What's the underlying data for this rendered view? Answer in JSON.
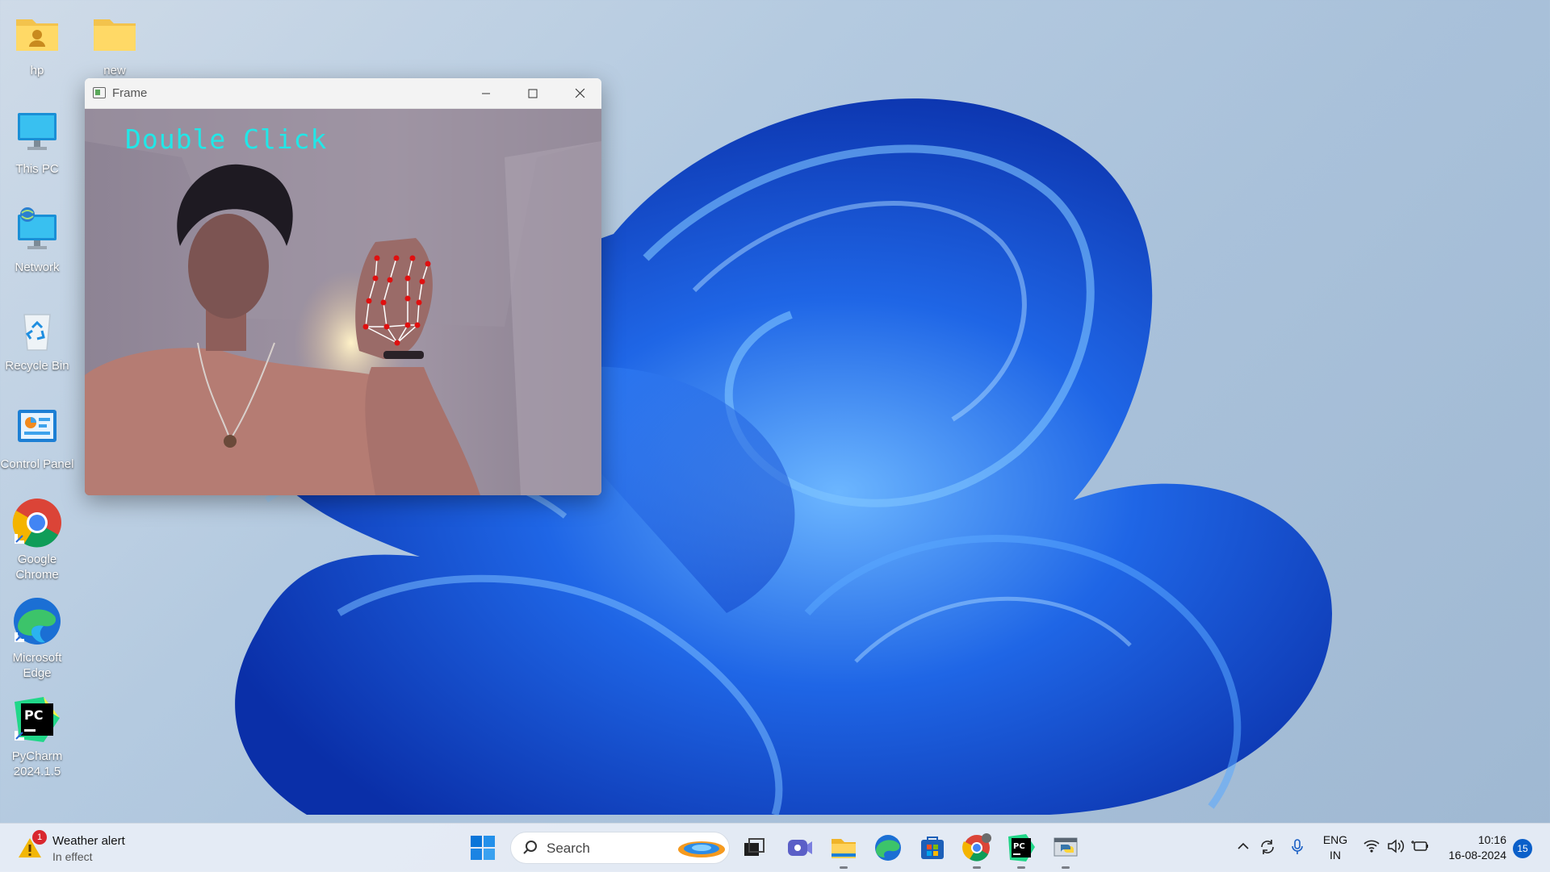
{
  "desktop": {
    "icons": [
      {
        "label": "hp"
      },
      {
        "label": "new"
      },
      {
        "label": "This PC"
      },
      {
        "label": "Network"
      },
      {
        "label": "Recycle Bin"
      },
      {
        "label": "Control Panel"
      },
      {
        "label": "Google Chrome"
      },
      {
        "label": "Microsoft Edge"
      },
      {
        "label": "PyCharm 2024.1.5"
      }
    ]
  },
  "window": {
    "title": "Frame",
    "overlay_text": "Double Click",
    "overlay_color": "#21e7e7",
    "landmark_color": "#e01010"
  },
  "taskbar": {
    "weather": {
      "title": "Weather alert",
      "subtitle": "In effect",
      "badge": "1"
    },
    "search": {
      "placeholder": "Search"
    },
    "apps": [
      "start-icon",
      "task-view-icon",
      "meet-icon",
      "file-explorer-icon",
      "edge-icon",
      "store-icon",
      "chrome-icon",
      "pycharm-icon",
      "python-icon"
    ],
    "tray": {
      "language": "ENG",
      "region": "IN",
      "time": "10:16",
      "date": "16-08-2024",
      "notifications": "15"
    }
  },
  "colors": {
    "accent": "#0a5fc9",
    "wallpaper_blue": "#1a5fe0"
  }
}
